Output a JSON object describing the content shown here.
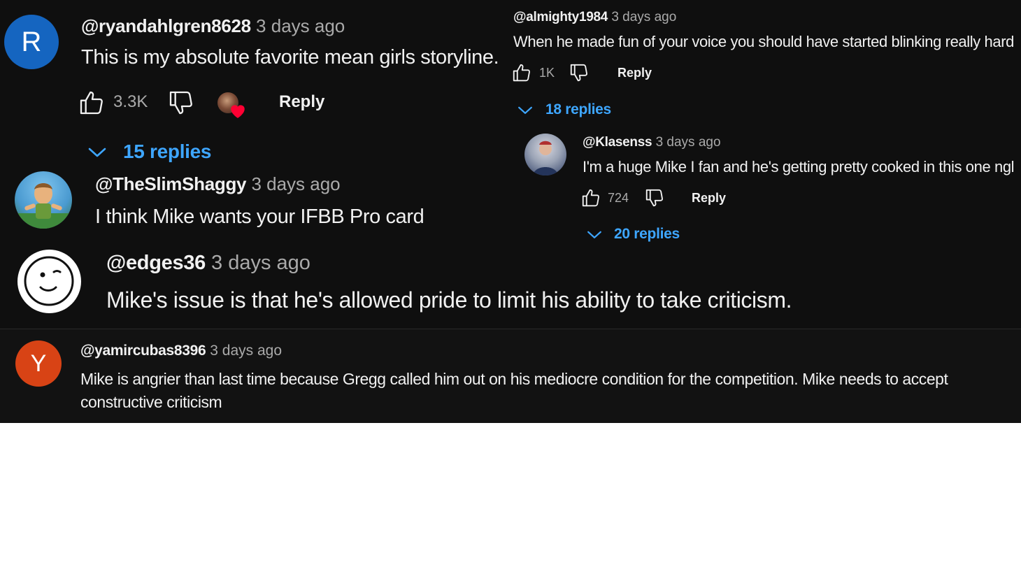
{
  "colors": {
    "background": "#0f0f0f",
    "text": "#f1f1f1",
    "secondary_text": "#aaaaaa",
    "replies_link": "#3ea6ff",
    "avatar_r": "#1565c0",
    "avatar_y": "#d84315",
    "heart": "#ff0033"
  },
  "comments": {
    "ryan": {
      "avatar_letter": "R",
      "handle": "@ryandahlgren8628",
      "time": "3 days ago",
      "text": "This is my absolute favorite mean girls storyline.",
      "likes": "3.3K",
      "reply_label": "Reply",
      "replies_label": "15 replies"
    },
    "shaggy": {
      "handle": "@TheSlimShaggy",
      "time": "3 days ago",
      "text": "I think Mike wants your IFBB Pro card"
    },
    "edges": {
      "handle": "@edges36",
      "time": "3 days ago",
      "text": "Mike's issue is that he's allowed pride to limit his ability to take criticism."
    },
    "almighty": {
      "handle": "@almighty1984",
      "time": "3 days ago",
      "text": "When he made fun of your voice you should have started blinking really hard",
      "likes": "1K",
      "reply_label": "Reply",
      "replies_label": "18 replies"
    },
    "klasenss": {
      "handle": "@Klasenss",
      "time": "3 days ago",
      "text": "I'm a huge Mike I fan and he's getting pretty cooked in this one ngl",
      "likes": "724",
      "reply_label": "Reply",
      "replies_label": "20 replies"
    },
    "yamir": {
      "avatar_letter": "Y",
      "handle": "@yamircubas8396",
      "time": "3 days ago",
      "text_line1": "Mike is angrier than last time because Gregg called him out on his mediocre condition for the competition. Mike needs to accept",
      "text_line2": "constructive criticism"
    }
  }
}
